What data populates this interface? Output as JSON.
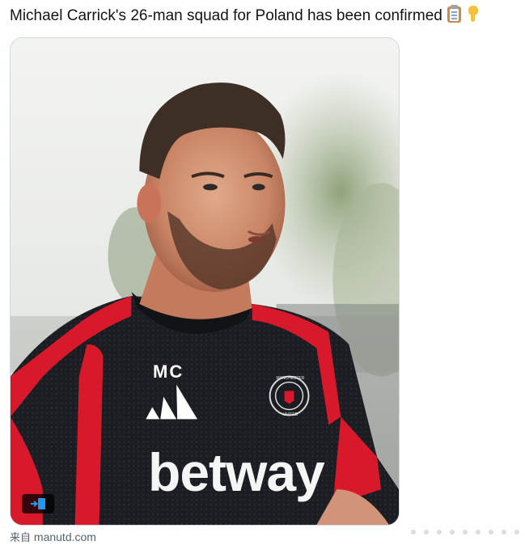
{
  "post": {
    "text": "Michael Carrick's 26-man squad for Poland has been confirmed",
    "emojis": [
      "clipboard-icon",
      "backhand-index-pointing-down-icon"
    ]
  },
  "media": {
    "shirt_initials": "MC",
    "shirt_sponsor": "betway",
    "crest_top": "MANCHESTER",
    "crest_bottom": "UNITED"
  },
  "source": {
    "prefix": "来自",
    "domain": "manutd.com"
  },
  "colors": {
    "text": "#0f1419",
    "muted": "#536471",
    "border": "#cfd9de",
    "shirt_dark": "#1a1c20",
    "shirt_red": "#d8182b"
  }
}
